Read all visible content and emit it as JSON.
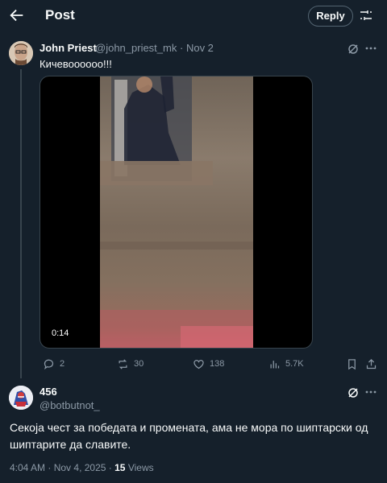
{
  "header": {
    "title": "Post",
    "reply_label": "Reply",
    "back_icon": "arrow-left-icon",
    "adjust_icon": "sliders-icon"
  },
  "original_post": {
    "author_name": "John Priest",
    "author_handle": "@john_priest_mk",
    "separator": "·",
    "date": "Nov 2",
    "text": "Кичевоооооо!!!",
    "video_duration": "0:14",
    "actions": {
      "replies": "2",
      "reposts": "30",
      "likes": "138",
      "views": "5.7K"
    }
  },
  "reply_post": {
    "author_name": "456",
    "author_handle": "@botbutnot_",
    "text": "Секоја чест за победата и промената, ама не мора по шиптарски од шиптарите да славите.",
    "time": "4:04 AM",
    "date": "Nov 4, 2025",
    "views_count": "15",
    "views_label": "Views"
  },
  "colors": {
    "background": "#15202b",
    "text": "#f7f9f9",
    "muted": "#8b98a5",
    "border": "#38444d"
  }
}
